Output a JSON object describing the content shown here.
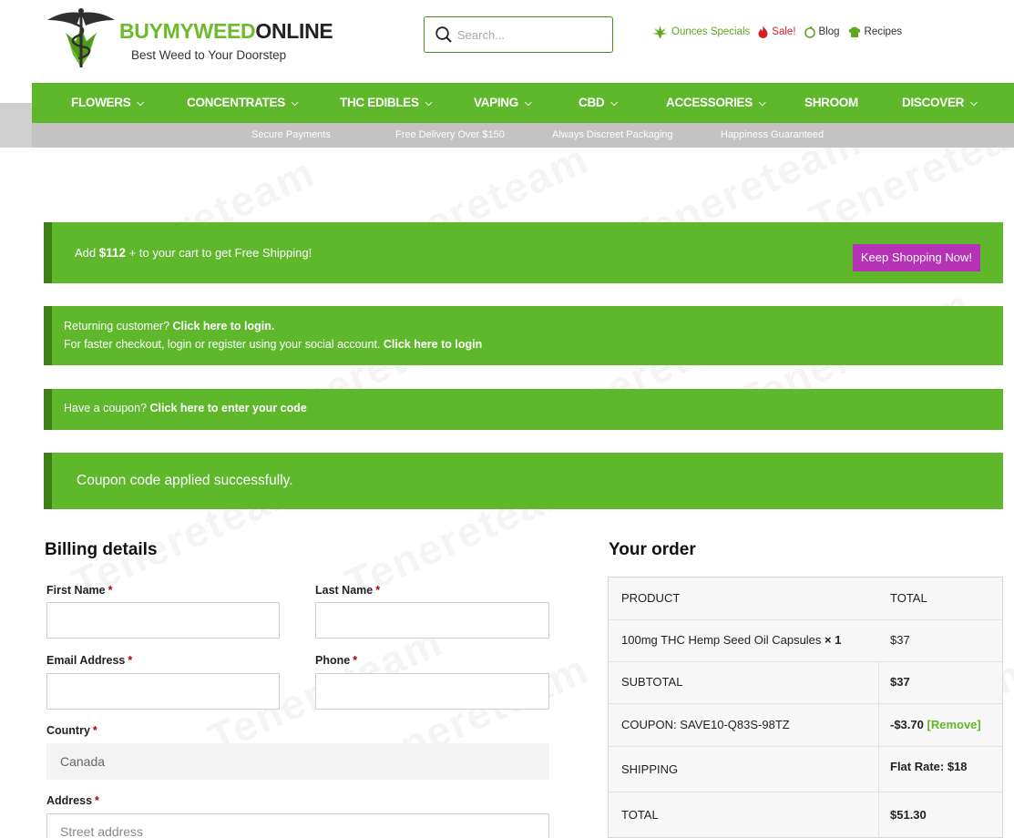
{
  "header": {
    "brand_part1": "BUYMYWEED",
    "brand_part2": "ONLINE",
    "tagline": "Best Weed to Your Doorstep",
    "search_placeholder": "Search...",
    "links": {
      "ounces": "Ounces Specials",
      "sale": "Sale!",
      "blog": "Blog",
      "recipes": "Recipes"
    }
  },
  "nav": {
    "flowers": "FLOWERS",
    "concentrates": "CONCENTRATES",
    "thc_edibles": "THC EDIBLES",
    "vaping": "VAPING",
    "cbd": "CBD",
    "accessories": "ACCESSORIES",
    "shroom": "SHROOM",
    "discover": "DISCOVER"
  },
  "subbar": {
    "secure": "Secure Payments",
    "delivery": "Free Delivery Over $150",
    "packaging": "Always Discreet Packaging",
    "happiness": "Happiness Guaranteed"
  },
  "notices": {
    "shipping_prefix": "Add ",
    "shipping_amount": "$112",
    "shipping_suffix": " + to your cart to get Free Shipping!",
    "keep_shopping": "Keep Shopping Now!",
    "returning_text": "Returning customer? ",
    "returning_link": "Click here to login.",
    "social_text": "For faster checkout, login or register using your social account. ",
    "social_link": "Click here to login",
    "coupon_text": "Have a coupon? ",
    "coupon_link": "Click here to enter your code",
    "coupon_applied": "Coupon code applied successfully."
  },
  "billing": {
    "title": "Billing details",
    "first_name_label": "First Name",
    "last_name_label": "Last Name",
    "email_label": "Email Address",
    "phone_label": "Phone",
    "country_label": "Country",
    "country_value": "Canada",
    "address_label": "Address",
    "address_placeholder": "Street address",
    "required_mark": "*"
  },
  "order": {
    "title": "Your order",
    "col_product": "PRODUCT",
    "col_total": "TOTAL",
    "item_name": "100mg THC Hemp Seed Oil Capsules",
    "item_qty": "× 1",
    "item_total": "$37",
    "subtotal_label": "SUBTOTAL",
    "subtotal_value": "$37",
    "coupon_label": "COUPON: SAVE10-Q83S-98TZ",
    "coupon_value": "-$3.70",
    "coupon_remove": "[Remove]",
    "shipping_label": "SHIPPING",
    "shipping_value": "Flat Rate: $18",
    "total_label": "TOTAL",
    "total_value": "$51.30"
  },
  "watermark": "Tenereteam",
  "colors": {
    "brand_green": "#5fb72b",
    "dark_green": "#3e7d18",
    "button_magenta": "#b531b5",
    "sale_red": "#d12020"
  }
}
